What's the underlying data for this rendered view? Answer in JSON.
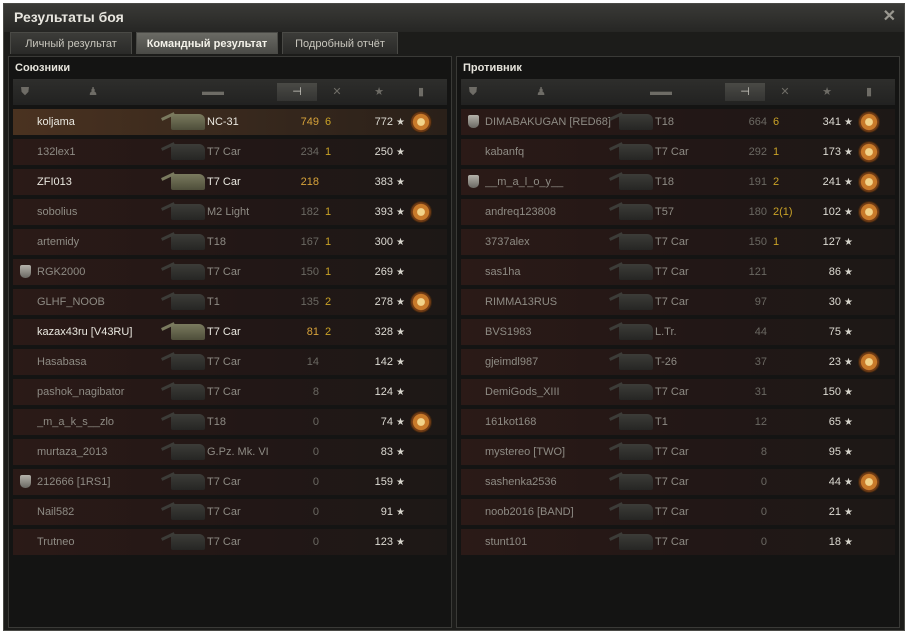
{
  "window": {
    "title": "Результаты боя"
  },
  "tabs": [
    {
      "label": "Личный результат",
      "active": false
    },
    {
      "label": "Командный результат",
      "active": true
    },
    {
      "label": "Подробный отчёт",
      "active": false
    }
  ],
  "allies": {
    "title": "Союзники",
    "rows": [
      {
        "name": "koljama",
        "tank": "NC-31",
        "damage": "749",
        "kills": "6",
        "exp": "772",
        "rank": false,
        "medal": true,
        "alive": true,
        "highlight": true
      },
      {
        "name": "132lex1",
        "tank": "T7 Car",
        "damage": "234",
        "kills": "1",
        "exp": "250",
        "rank": false,
        "medal": false,
        "alive": false,
        "highlight": false
      },
      {
        "name": "ZFI013",
        "tank": "T7 Car",
        "damage": "218",
        "kills": "",
        "exp": "383",
        "rank": false,
        "medal": false,
        "alive": true,
        "highlight": false
      },
      {
        "name": "sobolius",
        "tank": "M2 Light",
        "damage": "182",
        "kills": "1",
        "exp": "393",
        "rank": false,
        "medal": true,
        "alive": false,
        "highlight": false
      },
      {
        "name": "artemidy",
        "tank": "T18",
        "damage": "167",
        "kills": "1",
        "exp": "300",
        "rank": false,
        "medal": false,
        "alive": false,
        "highlight": false
      },
      {
        "name": "RGK2000",
        "tank": "T7 Car",
        "damage": "150",
        "kills": "1",
        "exp": "269",
        "rank": true,
        "medal": false,
        "alive": false,
        "highlight": false
      },
      {
        "name": "GLHF_NOOB",
        "tank": "T1",
        "damage": "135",
        "kills": "2",
        "exp": "278",
        "rank": false,
        "medal": true,
        "alive": false,
        "highlight": false
      },
      {
        "name": "kazax43ru [V43RU]",
        "tank": "T7 Car",
        "damage": "81",
        "kills": "2",
        "exp": "328",
        "rank": false,
        "medal": false,
        "alive": true,
        "highlight": false
      },
      {
        "name": "Hasabasa",
        "tank": "T7 Car",
        "damage": "14",
        "kills": "",
        "exp": "142",
        "rank": false,
        "medal": false,
        "alive": false,
        "highlight": false
      },
      {
        "name": "pashok_nagibator",
        "tank": "T7 Car",
        "damage": "8",
        "kills": "",
        "exp": "124",
        "rank": false,
        "medal": false,
        "alive": false,
        "highlight": false
      },
      {
        "name": "_m_a_k_s__zlo",
        "tank": "T18",
        "damage": "0",
        "kills": "",
        "exp": "74",
        "rank": false,
        "medal": true,
        "alive": false,
        "highlight": false
      },
      {
        "name": "murtaza_2013",
        "tank": "G.Pz. Mk. VI",
        "damage": "0",
        "kills": "",
        "exp": "83",
        "rank": false,
        "medal": false,
        "alive": false,
        "highlight": false
      },
      {
        "name": "212666 [1RS1]",
        "tank": "T7 Car",
        "damage": "0",
        "kills": "",
        "exp": "159",
        "rank": true,
        "medal": false,
        "alive": false,
        "highlight": false
      },
      {
        "name": "Nail582",
        "tank": "T7 Car",
        "damage": "0",
        "kills": "",
        "exp": "91",
        "rank": false,
        "medal": false,
        "alive": false,
        "highlight": false
      },
      {
        "name": "Trutneo",
        "tank": "T7 Car",
        "damage": "0",
        "kills": "",
        "exp": "123",
        "rank": false,
        "medal": false,
        "alive": false,
        "highlight": false
      }
    ]
  },
  "enemies": {
    "title": "Противник",
    "rows": [
      {
        "name": "DIMABAKUGAN [RED68]",
        "tank": "T18",
        "damage": "664",
        "kills": "6",
        "exp": "341",
        "rank": true,
        "medal": true,
        "alive": false,
        "highlight": false
      },
      {
        "name": "kabanfq",
        "tank": "T7 Car",
        "damage": "292",
        "kills": "1",
        "exp": "173",
        "rank": false,
        "medal": true,
        "alive": false,
        "highlight": false
      },
      {
        "name": "__m_a_l_o_y__",
        "tank": "T18",
        "damage": "191",
        "kills": "2",
        "exp": "241",
        "rank": true,
        "medal": true,
        "alive": false,
        "highlight": false
      },
      {
        "name": "andreq123808",
        "tank": "T57",
        "damage": "180",
        "kills": "2(1)",
        "exp": "102",
        "rank": false,
        "medal": true,
        "alive": false,
        "highlight": false
      },
      {
        "name": "3737alex",
        "tank": "T7 Car",
        "damage": "150",
        "kills": "1",
        "exp": "127",
        "rank": false,
        "medal": false,
        "alive": false,
        "highlight": false
      },
      {
        "name": "sas1ha",
        "tank": "T7 Car",
        "damage": "121",
        "kills": "",
        "exp": "86",
        "rank": false,
        "medal": false,
        "alive": false,
        "highlight": false
      },
      {
        "name": "RIMMA13RUS",
        "tank": "T7 Car",
        "damage": "97",
        "kills": "",
        "exp": "30",
        "rank": false,
        "medal": false,
        "alive": false,
        "highlight": false
      },
      {
        "name": "BVS1983",
        "tank": "L.Tr.",
        "damage": "44",
        "kills": "",
        "exp": "75",
        "rank": false,
        "medal": false,
        "alive": false,
        "highlight": false
      },
      {
        "name": "gjeimdl987",
        "tank": "T-26",
        "damage": "37",
        "kills": "",
        "exp": "23",
        "rank": false,
        "medal": true,
        "alive": false,
        "highlight": false
      },
      {
        "name": "DemiGods_XIII",
        "tank": "T7 Car",
        "damage": "31",
        "kills": "",
        "exp": "150",
        "rank": false,
        "medal": false,
        "alive": false,
        "highlight": false
      },
      {
        "name": "161kot168",
        "tank": "T1",
        "damage": "12",
        "kills": "",
        "exp": "65",
        "rank": false,
        "medal": false,
        "alive": false,
        "highlight": false
      },
      {
        "name": "mystereo [TWO]",
        "tank": "T7 Car",
        "damage": "8",
        "kills": "",
        "exp": "95",
        "rank": false,
        "medal": false,
        "alive": false,
        "highlight": false
      },
      {
        "name": "sashenka2536",
        "tank": "T7 Car",
        "damage": "0",
        "kills": "",
        "exp": "44",
        "rank": false,
        "medal": true,
        "alive": false,
        "highlight": false
      },
      {
        "name": "noob2016 [BAND]",
        "tank": "T7 Car",
        "damage": "0",
        "kills": "",
        "exp": "21",
        "rank": false,
        "medal": false,
        "alive": false,
        "highlight": false
      },
      {
        "name": "stunt101",
        "tank": "T7 Car",
        "damage": "0",
        "kills": "",
        "exp": "18",
        "rank": false,
        "medal": false,
        "alive": false,
        "highlight": false
      }
    ]
  },
  "columns": {
    "rank_icon": "shield-icon",
    "player_icon": "player-icon",
    "tank_icon": "tank-icon",
    "damage_icon": "damage-icon",
    "kills_icon": "kills-icon",
    "exp_icon": "star-icon",
    "medal_icon": "medal-icon",
    "star_glyph": "★"
  },
  "colors": {
    "kills": "#c9a227",
    "damage_alive": "#d6a23a",
    "row_dead": "#2b1a17",
    "row_highlight": "#4a3220"
  }
}
